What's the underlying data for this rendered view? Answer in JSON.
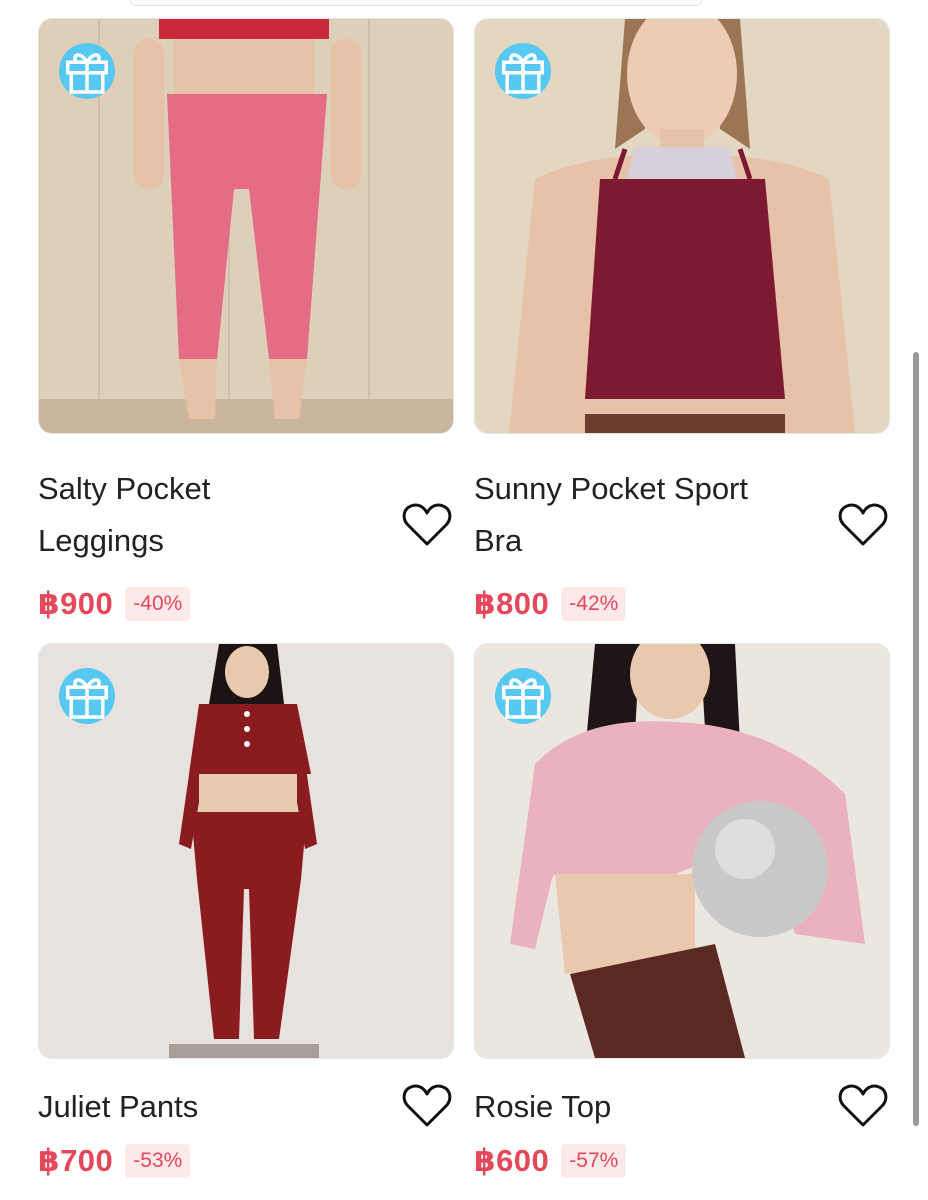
{
  "colors": {
    "price": "#e5485b",
    "discount_bg": "#fde8ea",
    "gift_badge": "#57c8f2"
  },
  "products": [
    {
      "title_line1": "Salty Pocket",
      "title_line2": "Leggings",
      "price": "฿900",
      "discount": "-40%",
      "badge_icon": "gift-icon",
      "favorite_icon": "heart-outline-icon"
    },
    {
      "title_line1": "Sunny Pocket Sport",
      "title_line2": "Bra",
      "price": "฿800",
      "discount": "-42%",
      "badge_icon": "gift-icon",
      "favorite_icon": "heart-outline-icon"
    },
    {
      "title_line1": "Juliet Pants",
      "title_line2": "",
      "price": "฿700",
      "discount": "-53%",
      "badge_icon": "gift-icon",
      "favorite_icon": "heart-outline-icon"
    },
    {
      "title_line1": "Rosie Top",
      "title_line2": "",
      "price": "฿600",
      "discount": "-57%",
      "badge_icon": "gift-icon",
      "favorite_icon": "heart-outline-icon"
    }
  ]
}
